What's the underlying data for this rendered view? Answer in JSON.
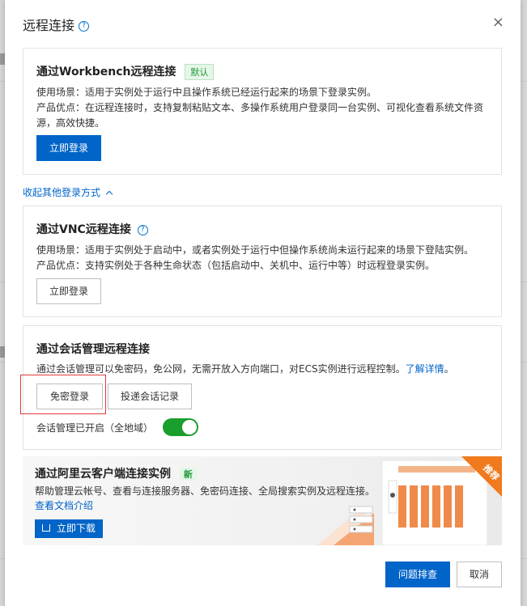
{
  "dialog": {
    "title": "远程连接",
    "close_label": "×"
  },
  "workbench": {
    "title": "通过Workbench远程连接",
    "tag": "默认",
    "scene": "使用场景：适用于实例处于运行中且操作系统已经运行起来的场景下登录实例。",
    "advantage": "产品优点：在远程连接时，支持复制粘贴文本、多操作系统用户登录同一台实例、可视化查看系统文件资源，高效快捷。",
    "login_button": "立即登录"
  },
  "collapse_link": "收起其他登录方式",
  "vnc": {
    "title": "通过VNC远程连接",
    "scene": "使用场景：适用于实例处于启动中，或者实例处于运行中但操作系统尚未运行起来的场景下登陆实例。",
    "advantage": "产品优点：支持实例处于各种生命状态（包括启动中、关机中、运行中等）时远程登录实例。",
    "login_button": "立即登录"
  },
  "session": {
    "title": "通过会话管理远程连接",
    "desc": "通过会话管理可以免密码，免公网，无需开放入方向端口，对ECS实例进行远程控制。",
    "learn_more": "了解详情",
    "learn_more_suffix": "。",
    "passwordless_button": "免密登录",
    "deliver_button": "投递会话记录",
    "status_label": "会话管理已开启（全地域）",
    "enabled": true
  },
  "client": {
    "title": "通过阿里云客户端连接实例",
    "tag": "新",
    "desc": "帮助管理云帐号、查看与连接服务器、免密码连接、全局搜索实例及远程连接。",
    "doc_link": "查看文档介绍",
    "download_button": "立即下载",
    "ribbon": "推荐"
  },
  "footer": {
    "troubleshoot_button": "问题排查",
    "cancel_button": "取消"
  },
  "colors": {
    "primary": "#0064c8",
    "success": "#1a9e2e",
    "highlight": "#e03b3b",
    "ribbon": "#f07a1d"
  }
}
